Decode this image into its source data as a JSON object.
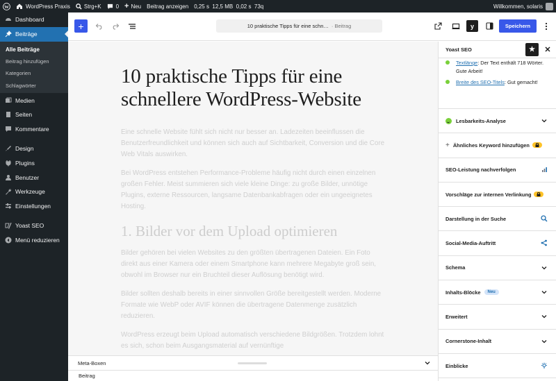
{
  "admin_bar": {
    "site_name": "WordPress Praxis",
    "search_shortcut": "Strg+K",
    "comments_count": "0",
    "new_label": "Neu",
    "view_post_label": "Beitrag anzeigen",
    "debug_stats": "0,25 s  12,5 MB  0,02 s  73q",
    "greeting": "Willkommen, solaris"
  },
  "sidebar": {
    "items": [
      {
        "label": "Dashboard",
        "icon": "dashboard-icon"
      },
      {
        "label": "Beiträge",
        "icon": "pin-icon",
        "active": true
      },
      {
        "label": "Medien",
        "icon": "media-icon"
      },
      {
        "label": "Seiten",
        "icon": "page-icon"
      },
      {
        "label": "Kommentare",
        "icon": "comment-icon"
      },
      {
        "label": "Design",
        "icon": "brush-icon"
      },
      {
        "label": "Plugins",
        "icon": "plugin-icon"
      },
      {
        "label": "Benutzer",
        "icon": "user-icon"
      },
      {
        "label": "Werkzeuge",
        "icon": "wrench-icon"
      },
      {
        "label": "Einstellungen",
        "icon": "settings-icon"
      },
      {
        "label": "Yoast SEO",
        "icon": "yoast-icon"
      },
      {
        "label": "Menü reduzieren",
        "icon": "collapse-icon"
      }
    ],
    "submenu": [
      "Alle Beiträge",
      "Beitrag hinzufügen",
      "Kategorien",
      "Schlagwörter"
    ]
  },
  "toolbar": {
    "document_title": "10 praktische Tipps für eine schn…",
    "document_type": "· Beitrag",
    "yoast_label": "y",
    "save_label": "Speichern"
  },
  "post": {
    "title": "10 praktische Tipps für eine schnellere WordPress-Website",
    "paragraphs_intro": [
      "Eine schnelle Website fühlt sich nicht nur besser an. Ladezeiten beeinflussen die Benutzerfreundlichkeit und können sich auch auf Sichtbarkeit, Conversion und die Core Web Vitals auswirken.",
      "Bei WordPress entstehen Performance-Probleme häufig nicht durch einen einzelnen großen Fehler. Meist summieren sich viele kleine Dinge: zu große Bilder, unnötige Plugins, externe Ressourcen, langsame Datenbankabfragen oder ein ungeeignetes Hosting."
    ],
    "heading_1": "1. Bilder vor dem Upload optimieren",
    "paragraphs_section": [
      "Bilder gehören bei vielen Websites zu den größten übertragenen Dateien. Ein Foto direkt aus einer Kamera oder einem Smartphone kann mehrere Megabyte groß sein, obwohl im Browser nur ein Bruchteil dieser Auflösung benötigt wird.",
      "Bilder sollten deshalb bereits in einer sinnvollen Größe bereitgestellt werden. Moderne Formate wie WebP oder AVIF können die übertragene Datenmenge zusätzlich reduzieren.",
      "WordPress erzeugt beim Upload automatisch verschiedene Bildgrößen. Trotzdem lohnt es sich, schon beim Ausgangsmaterial auf vernünftige"
    ]
  },
  "meta_boxes_label": "Meta-Boxen",
  "footer_label": "Beitrag",
  "yoast_panel": {
    "title": "Yoast SEO",
    "results": [
      {
        "link": "Textlänge",
        "text": ": Der Text enthält 718 Wörter. Gute Arbeit!"
      },
      {
        "link": "Breite des SEO-Titels",
        "text": ": Gut gemacht!"
      }
    ],
    "sections": [
      {
        "label": "Lesbarkeits-Analyse",
        "icon": "smiley-icon",
        "right": "chevron-down-icon"
      },
      {
        "label": "Ähnliches Keyword hinzufügen",
        "icon": "plus-icon",
        "right": "lock-icon"
      },
      {
        "label": "SEO-Leistung nachverfolgen",
        "right": "bar-chart-icon"
      },
      {
        "label": "Vorschläge zur internen Verlinkung",
        "right": "lock-icon"
      },
      {
        "label": "Darstellung in der Suche",
        "right": "search-icon"
      },
      {
        "label": "Social-Media-Auftritt",
        "right": "share-icon"
      },
      {
        "label": "Schema",
        "right": "chevron-down-icon"
      },
      {
        "label": "Inhalts-Blöcke",
        "badge": "Neu",
        "right": "chevron-down-icon"
      },
      {
        "label": "Erweitert",
        "right": "chevron-down-icon"
      },
      {
        "label": "Cornerstone-Inhalt",
        "right": "chevron-down-icon"
      },
      {
        "label": "Einblicke",
        "right": "bulb-icon"
      }
    ]
  },
  "colors": {
    "admin_dark": "#1d2327",
    "wp_blue": "#2271b1",
    "editor_blue": "#3858e9",
    "good_green": "#7ad03a",
    "premium_yellow": "#fec228"
  }
}
